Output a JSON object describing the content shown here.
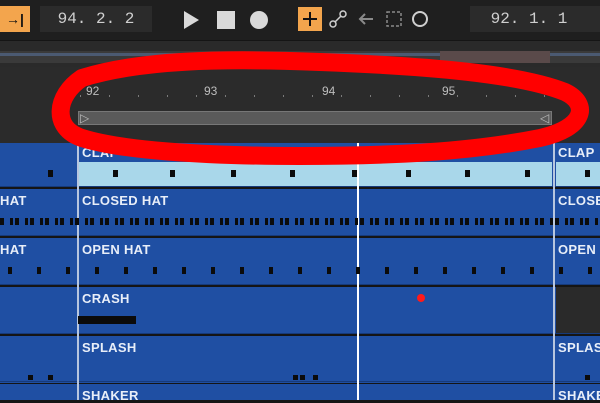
{
  "transport": {
    "arrangement_position": "94. 2. 2",
    "loop_start": "92. 1. 1",
    "follow_icon": "follow-arrow-icon",
    "play_icon": "play-icon",
    "stop_icon": "stop-icon",
    "record_icon": "record-circle-icon",
    "draw_icon": "plus-icon",
    "automation_icon": "automation-icon",
    "back_icon": "back-arrow-icon",
    "punch_icon": "punch-in-icon",
    "loop_icon": "circle-icon"
  },
  "ruler": {
    "bars": [
      "92",
      "93",
      "94",
      "95"
    ]
  },
  "lanes": [
    {
      "name": "CLAP",
      "left_label": "",
      "right_label": "CLAP"
    },
    {
      "name": "CLOSED HAT",
      "left_label": "HAT",
      "right_label": "CLOSE"
    },
    {
      "name": "OPEN HAT",
      "left_label": "HAT",
      "right_label": "OPEN"
    },
    {
      "name": "CRASH",
      "left_label": "",
      "right_label": ""
    },
    {
      "name": "SPLASH",
      "left_label": "",
      "right_label": "SPLAS"
    },
    {
      "name": "SHAKER",
      "left_label": "",
      "right_label": "SHAKE"
    }
  ],
  "colors": {
    "lane_blue": "#1f4fa3",
    "clip_light": "#a9d7ea",
    "transport_accent": "#f3a54d",
    "annotation_red": "#ff0000"
  }
}
